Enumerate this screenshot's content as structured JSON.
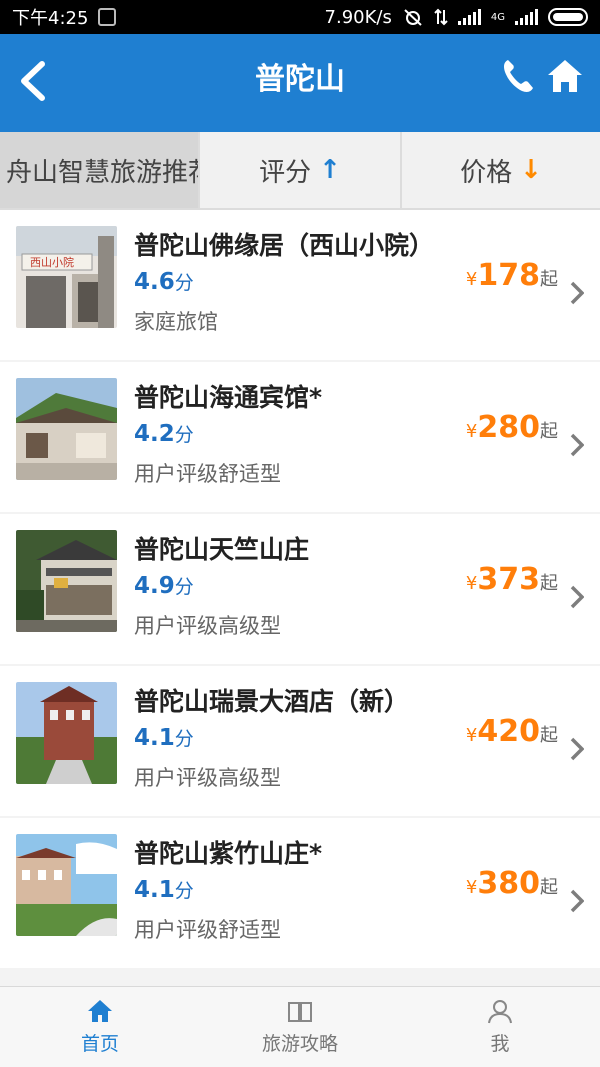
{
  "statusbar": {
    "time": "下午4:25",
    "speed": "7.90K/s",
    "network": "4G"
  },
  "appbar": {
    "title": "普陀山",
    "icons": [
      "back-arrow-icon",
      "phone-icon",
      "home-icon"
    ]
  },
  "tabs": [
    {
      "label": "舟山智慧旅游推荐"
    },
    {
      "label": "评分",
      "arrow": "↑"
    },
    {
      "label": "价格",
      "arrow": "↓"
    }
  ],
  "hotels": [
    {
      "name": "普陀山佛缘居（西山小院）",
      "score": "4.6",
      "score_unit": "分",
      "type": "家庭旅馆",
      "yen": "¥",
      "price": "178",
      "suffix": "起"
    },
    {
      "name": "普陀山海通宾馆*",
      "score": "4.2",
      "score_unit": "分",
      "type": "用户评级舒适型",
      "yen": "¥",
      "price": "280",
      "suffix": "起"
    },
    {
      "name": "普陀山天竺山庄",
      "score": "4.9",
      "score_unit": "分",
      "type": "用户评级高级型",
      "yen": "¥",
      "price": "373",
      "suffix": "起"
    },
    {
      "name": "普陀山瑞景大酒店（新）",
      "score": "4.1",
      "score_unit": "分",
      "type": "用户评级高级型",
      "yen": "¥",
      "price": "420",
      "suffix": "起"
    },
    {
      "name": "普陀山紫竹山庄*",
      "score": "4.1",
      "score_unit": "分",
      "type": "用户评级舒适型",
      "yen": "¥",
      "price": "380",
      "suffix": "起"
    }
  ],
  "bottomnav": [
    {
      "label": "首页",
      "icon": "home-icon",
      "active": true
    },
    {
      "label": "旅游攻略",
      "icon": "book-icon"
    },
    {
      "label": "我",
      "icon": "person-icon"
    }
  ],
  "colors": {
    "primary": "#1f7fd1",
    "price": "#ff7e0a",
    "score": "#1f6ebf"
  }
}
